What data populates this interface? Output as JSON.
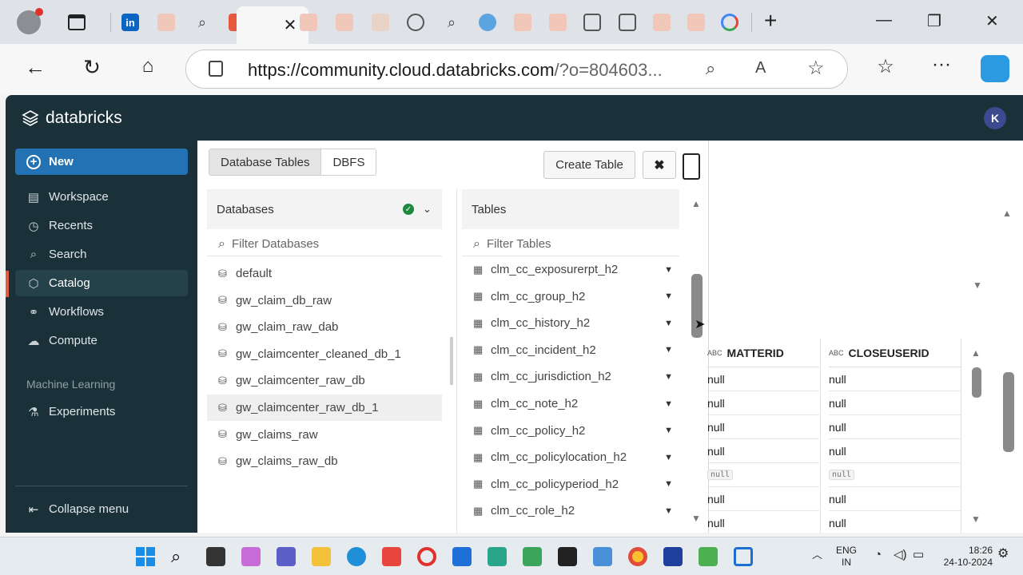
{
  "browser": {
    "url_main": "https://community.cloud.databricks.com",
    "url_rest": "/?o=804603...",
    "close_tab": "✕",
    "new_tab": "+"
  },
  "app": {
    "brand": "databricks",
    "avatar_initial": "K"
  },
  "sidebar": {
    "new_label": "New",
    "items": [
      {
        "label": "Workspace",
        "icon": "workspace-icon"
      },
      {
        "label": "Recents",
        "icon": "clock-icon"
      },
      {
        "label": "Search",
        "icon": "search-icon"
      },
      {
        "label": "Catalog",
        "icon": "catalog-icon"
      },
      {
        "label": "Workflows",
        "icon": "workflows-icon"
      },
      {
        "label": "Compute",
        "icon": "cloud-icon"
      }
    ],
    "section_ml": "Machine Learning",
    "experiments": "Experiments",
    "collapse": "Collapse menu"
  },
  "panel": {
    "tabs": [
      "Database Tables",
      "DBFS"
    ],
    "create_table": "Create Table",
    "close": "✖",
    "databases_header": "Databases",
    "databases_filter": "Filter Databases",
    "databases": [
      "default",
      "gw_claim_db_raw",
      "gw_claim_raw_dab",
      "gw_claimcenter_cleaned_db_1",
      "gw_claimcenter_raw_db",
      "gw_claimcenter_raw_db_1",
      "gw_claims_raw",
      "gw_claims_raw_db"
    ],
    "selected_database": "gw_claimcenter_raw_db_1",
    "tables_header": "Tables",
    "tables_filter": "Filter Tables",
    "tables": [
      "clm_cc_exposurerpt_h2",
      "clm_cc_group_h2",
      "clm_cc_history_h2",
      "clm_cc_incident_h2",
      "clm_cc_jurisdiction_h2",
      "clm_cc_note_h2",
      "clm_cc_policy_h2",
      "clm_cc_policylocation_h2",
      "clm_cc_policyperiod_h2",
      "clm_cc_role_h2"
    ]
  },
  "grid": {
    "type_badge": "ABC",
    "columns": [
      "MATTERID",
      "CLOSEUSERID"
    ],
    "rows": [
      "null",
      "null",
      "null",
      "null",
      "null",
      "null",
      "null"
    ],
    "badge_row_index": 4
  },
  "taskbar": {
    "lang_line1": "ENG",
    "lang_line2": "IN",
    "time": "18:26",
    "date": "24-10-2024"
  }
}
